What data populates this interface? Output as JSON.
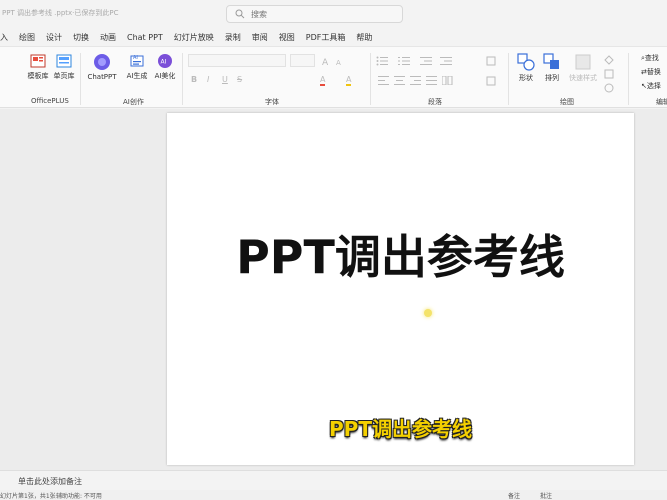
{
  "window": {
    "title": "PPT 调出参考线 .pptx·已保存到此PC",
    "search_placeholder": "搜索"
  },
  "tabs": [
    "入",
    "绘图",
    "设计",
    "切换",
    "动画",
    "Chat PPT",
    "幻灯片放映",
    "录制",
    "审阅",
    "视图",
    "PDF工具箱",
    "帮助"
  ],
  "ribbon": {
    "officeplus": {
      "label": "OfficePLUS",
      "buttons": [
        "模板库",
        "单页库"
      ]
    },
    "ai": {
      "label": "AI创作",
      "buttons": [
        "ChatPPT",
        "AI生成",
        "AI美化"
      ]
    },
    "font": {
      "label": "字体",
      "controls": [
        "B",
        "I",
        "U",
        "S",
        "A",
        "A"
      ]
    },
    "paragraph": {
      "label": "段落"
    },
    "drawing": {
      "label": "绘图",
      "buttons": [
        "形状",
        "排列",
        "快速样式"
      ]
    },
    "edit": {
      "label": "编辑",
      "buttons": [
        "查找",
        "替换",
        "选择"
      ]
    }
  },
  "slide": {
    "title": "PPT调出参考线"
  },
  "subtitle": "PPT调出参考线",
  "notes": {
    "placeholder": "单击此处添加备注"
  },
  "status": {
    "left": "幻灯片第1张，共1张",
    "accessibility": "辅助功能: 不可用",
    "notes_btn": "备注",
    "comments_btn": "批注"
  },
  "colors": {
    "subtitle_fill": "#f4d000",
    "accent_blue": "#3a6fd8",
    "accent_purple": "#7b4fd8"
  }
}
